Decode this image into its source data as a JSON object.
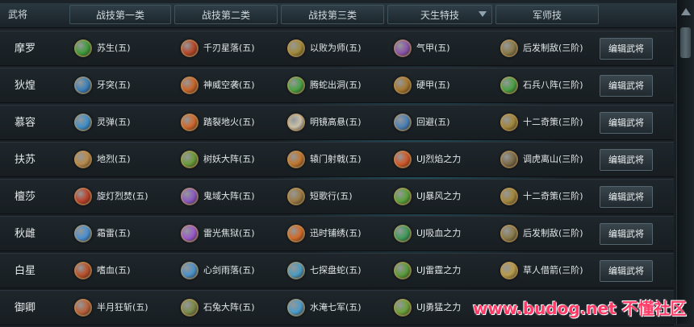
{
  "header": {
    "col_general": "武将",
    "col_skill1": "战技第一类",
    "col_skill2": "战技第二类",
    "col_skill3": "战技第三类",
    "col_innate": "天生特技",
    "col_strategist": "军师技"
  },
  "edit_label": "编辑武将",
  "watermark": "www.budog.net 不懂社区",
  "rows": [
    {
      "name": "摩罗",
      "s1": "苏生(五)",
      "s2": "千刃星落(五)",
      "s3": "以败为师(五)",
      "s4": "气甲(五)",
      "s5": "后发制敌(三阶)",
      "c1": "#3f9a3a",
      "c2": "#b5472a",
      "c3": "#a08a3a",
      "c4": "#8a55a8",
      "c5": "#8a7a4a"
    },
    {
      "name": "狄煌",
      "s1": "牙突(五)",
      "s2": "神威空袭(五)",
      "s3": "腾蛇出洞(五)",
      "s4": "硬甲(五)",
      "s5": "石兵八阵(三阶)",
      "c1": "#3b7fb8",
      "c2": "#c9642a",
      "c3": "#4aa044",
      "c4": "#a5772f",
      "c5": "#4aa044"
    },
    {
      "name": "慕容",
      "s1": "灵弹(五)",
      "s2": "踏裂地火(五)",
      "s3": "明镜高悬(五)",
      "s4": "回避(五)",
      "s5": "十二奇策(三阶)",
      "c1": "#3f8fc8",
      "c2": "#d0682c",
      "c3": "#c9c0a8",
      "c4": "#4b7fb5",
      "c5": "#a2863c"
    },
    {
      "name": "扶苏",
      "s1": "地烈(五)",
      "s2": "树妖大阵(五)",
      "s3": "辕门射戟(五)",
      "s4": "UJ烈焰之力",
      "s5": "调虎离山(三阶)",
      "c1": "#b88a4a",
      "c2": "#6a9a3a",
      "c3": "#c0762e",
      "c4": "#d0582a",
      "c5": "#7c6a48"
    },
    {
      "name": "檀莎",
      "s1": "旋灯烈焚(五)",
      "s2": "鬼域大阵(五)",
      "s3": "短歌行(五)",
      "s4": "UJ暴风之力",
      "s5": "十二奇策(三阶)",
      "c1": "#b8402a",
      "c2": "#8a5ac0",
      "c3": "#9a7a44",
      "c4": "#5aa03a",
      "c5": "#a2863c"
    },
    {
      "name": "秋雌",
      "s1": "霜雷(五)",
      "s2": "雷光焦狱(五)",
      "s3": "迅时铺绣(五)",
      "s4": "UJ吸血之力",
      "s5": "后发制敌(三阶)",
      "c1": "#4a8fd0",
      "c2": "#9a5ac8",
      "c3": "#d06a2a",
      "c4": "#3f9a5a",
      "c5": "#8a7a4a"
    },
    {
      "name": "白星",
      "s1": "嗜血(五)",
      "s2": "心剑雨落(五)",
      "s3": "七探盘蛇(五)",
      "s4": "UJ雷霆之力",
      "s5": "草人借箭(三阶)",
      "c1": "#b8502a",
      "c2": "#4a90c8",
      "c3": "#4a9ac0",
      "c4": "#5a9a3a",
      "c5": "#b89a4a"
    },
    {
      "name": "御卿",
      "s1": "半月狂斩(五)",
      "s2": "石兔大阵(五)",
      "s3": "水淹七军(五)",
      "s4": "UJ勇猛之力",
      "s5": "",
      "c1": "#b8603a",
      "c2": "#7a8a4a",
      "c3": "#4a9ac8",
      "c4": "#6aa03a",
      "c5": ""
    }
  ]
}
